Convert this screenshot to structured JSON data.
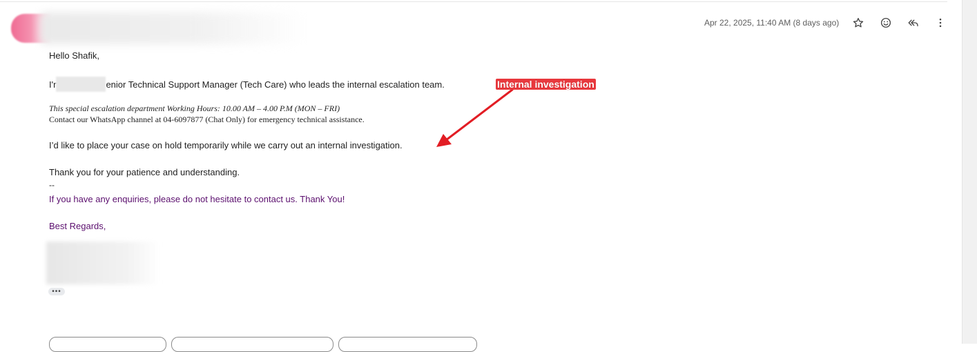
{
  "header": {
    "datetime": "Apr 22, 2025, 11:40 AM (8 days ago)"
  },
  "icons": {
    "star": "star-icon",
    "emoji": "emoji-icon",
    "reply_all": "reply-all-icon",
    "more": "more-vert-icon"
  },
  "email": {
    "greeting": "Hello Shafik,",
    "intro_prefix": "I'r",
    "intro_suffix": "enior Technical Support Manager (Tech Care) who leads the internal escalation team.",
    "hours": "This special escalation department Working Hours: 10.00 AM – 4.00 P.M  (MON – FRI)",
    "whatsapp": "Contact our WhatsApp channel at 04-6097877 (Chat Only) for emergency technical assistance.",
    "hold_notice": "I’d like to place your case on hold temporarily while we carry out an internal investigation.",
    "thanks": "Thank you for your patience and understanding.",
    "separator": "--",
    "enquiries": "If you have any enquiries, please do not hesitate to contact us. Thank You!",
    "regards": "Best Regards,",
    "show_trimmed": "•••"
  },
  "annotation": {
    "label": "Internal investigation",
    "color": "#e8383d"
  },
  "colors": {
    "purple_text": "#5b0f6e",
    "meta_text": "#5e5e5e"
  }
}
